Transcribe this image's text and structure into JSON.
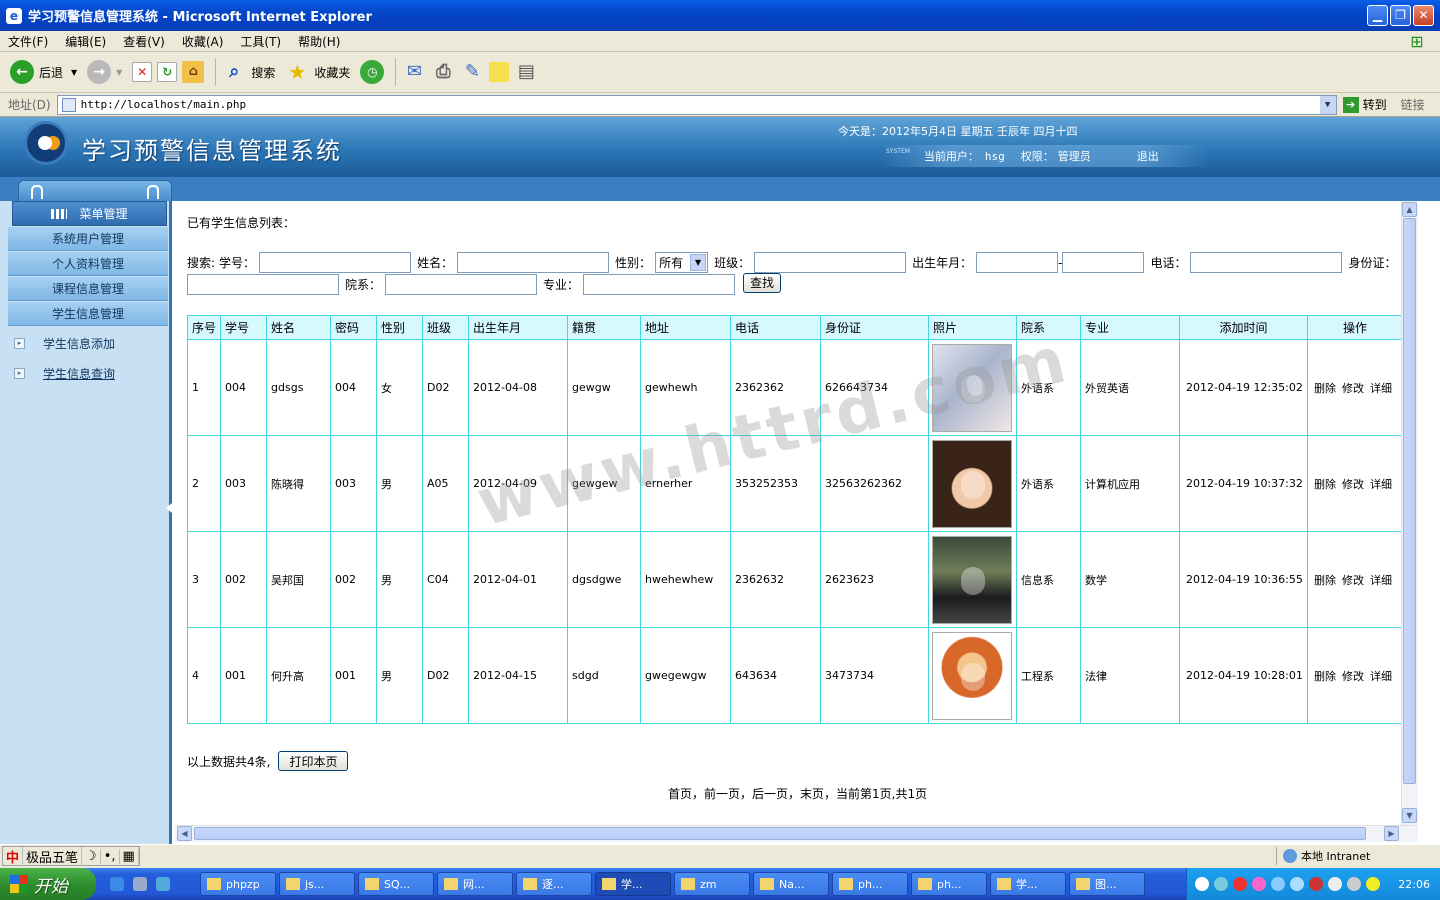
{
  "window": {
    "title": "学习预警信息管理系统 - Microsoft Internet Explorer"
  },
  "menubar": [
    "文件(F)",
    "编辑(E)",
    "查看(V)",
    "收藏(A)",
    "工具(T)",
    "帮助(H)"
  ],
  "toolbar": {
    "back": "后退",
    "search": "搜索",
    "favorites": "收藏夹"
  },
  "address": {
    "label": "地址(D)",
    "url": "http://localhost/main.php",
    "go": "转到",
    "links": "链接"
  },
  "app": {
    "title": "学习预警信息管理系统",
    "today": "今天是：2012年5月4日 星期五 壬辰年 四月十四",
    "system_tag": "SYSTEM",
    "current_user_label": "当前用户：",
    "current_user": "hsg",
    "role_label": "权限：",
    "role": "管理员",
    "logout": "退出"
  },
  "sidebar": {
    "menu_header": "菜单管理",
    "items": [
      "系统用户管理",
      "个人资料管理",
      "课程信息管理",
      "学生信息管理"
    ],
    "links": [
      "学生信息添加",
      "学生信息查询"
    ]
  },
  "main": {
    "list_title": "已有学生信息列表：",
    "search": {
      "label": "搜索:",
      "sno": "学号：",
      "name": "姓名：",
      "sex": "性别：",
      "sex_value": "所有",
      "class": "班级：",
      "birth": "出生年月：",
      "dash": "-",
      "phone": "电话：",
      "idcard": "身份证：",
      "dept": "院系：",
      "major": "专业：",
      "find": "查找"
    },
    "columns": [
      "序号",
      "学号",
      "姓名",
      "密码",
      "性别",
      "班级",
      "出生年月",
      "籍贯",
      "地址",
      "电话",
      "身份证",
      "照片",
      "院系",
      "专业",
      "添加时间",
      "操作"
    ],
    "rows": [
      {
        "idx": "1",
        "sno": "004",
        "name": "gdsgs",
        "pwd": "004",
        "sex": "女",
        "cls": "D02",
        "birth": "2012-04-08",
        "origin": "gewgw",
        "addr": "gewhewh",
        "phone": "2362362",
        "idcard": "626643734",
        "dept": "外语系",
        "major": "外贸英语",
        "added": "2012-04-19 12:35:02"
      },
      {
        "idx": "2",
        "sno": "003",
        "name": "陈晓得",
        "pwd": "003",
        "sex": "男",
        "cls": "A05",
        "birth": "2012-04-09",
        "origin": "gewgew",
        "addr": "ernerher",
        "phone": "353252353",
        "idcard": "32563262362",
        "dept": "外语系",
        "major": "计算机应用",
        "added": "2012-04-19 10:37:32"
      },
      {
        "idx": "3",
        "sno": "002",
        "name": "吴邦国",
        "pwd": "002",
        "sex": "男",
        "cls": "C04",
        "birth": "2012-04-01",
        "origin": "dgsdgwe",
        "addr": "hwehewhew",
        "phone": "2362632",
        "idcard": "2623623",
        "dept": "信息系",
        "major": "数学",
        "added": "2012-04-19 10:36:55"
      },
      {
        "idx": "4",
        "sno": "001",
        "name": "何升高",
        "pwd": "001",
        "sex": "男",
        "cls": "D02",
        "birth": "2012-04-15",
        "origin": "sdgd",
        "addr": "gwegewgw",
        "phone": "643634",
        "idcard": "3473734",
        "dept": "工程系",
        "major": "法律",
        "added": "2012-04-19 10:28:01"
      }
    ],
    "ops": {
      "delete": "删除",
      "edit": "修改",
      "detail": "详细"
    },
    "summary": "以上数据共4条,",
    "print": "打印本页",
    "pager": "首页，前一页，后一页，末页，当前第1页,共1页",
    "watermark": "www.httrd.com"
  },
  "status": {
    "ime": [
      "中",
      "极品五笔",
      "☽",
      "•,",
      "▦"
    ],
    "zone": "本地 Intranet"
  },
  "taskbar": {
    "start": "开始",
    "tasks": [
      "phpzp",
      "js...",
      "SQ...",
      "网...",
      "逐...",
      "学...",
      "zm",
      "Na...",
      "ph...",
      "ph...",
      "学...",
      "图..."
    ],
    "clock": "22:06"
  }
}
